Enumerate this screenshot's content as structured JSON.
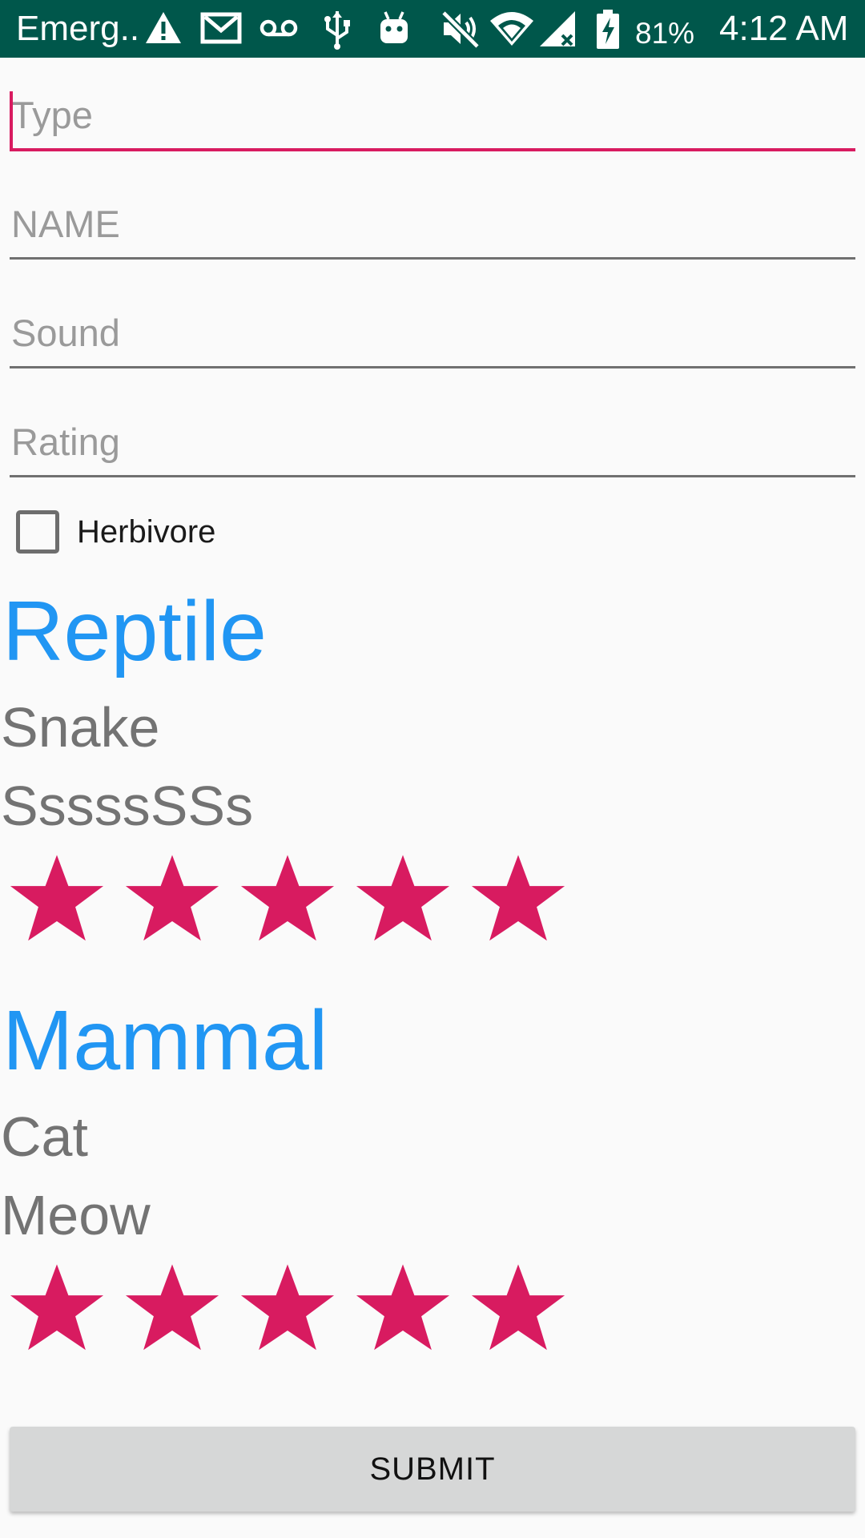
{
  "status_bar": {
    "carrier": "Emerg..",
    "battery": "81%",
    "time": "4:12 AM",
    "icons": [
      "warning-icon",
      "gmail-icon",
      "voicemail-icon",
      "usb-icon",
      "android-icon",
      "mute-icon",
      "wifi-icon",
      "signal-icon",
      "battery-charging-icon"
    ]
  },
  "form": {
    "type_placeholder": "Type",
    "name_placeholder": "NAME",
    "sound_placeholder": "Sound",
    "rating_placeholder": "Rating",
    "herbivore_label": "Herbivore",
    "herbivore_checked": false,
    "submit_label": "SUBMIT"
  },
  "animals": [
    {
      "type": "Reptile",
      "name": "Snake",
      "sound": "SssssSSs",
      "rating": 5,
      "max_rating": 5
    },
    {
      "type": "Mammal",
      "name": "Cat",
      "sound": "Meow",
      "rating": 5,
      "max_rating": 5
    }
  ],
  "colors": {
    "status_bar": "#00574b",
    "accent": "#d81b60",
    "type_title": "#2196f3",
    "secondary_text": "#737373"
  }
}
